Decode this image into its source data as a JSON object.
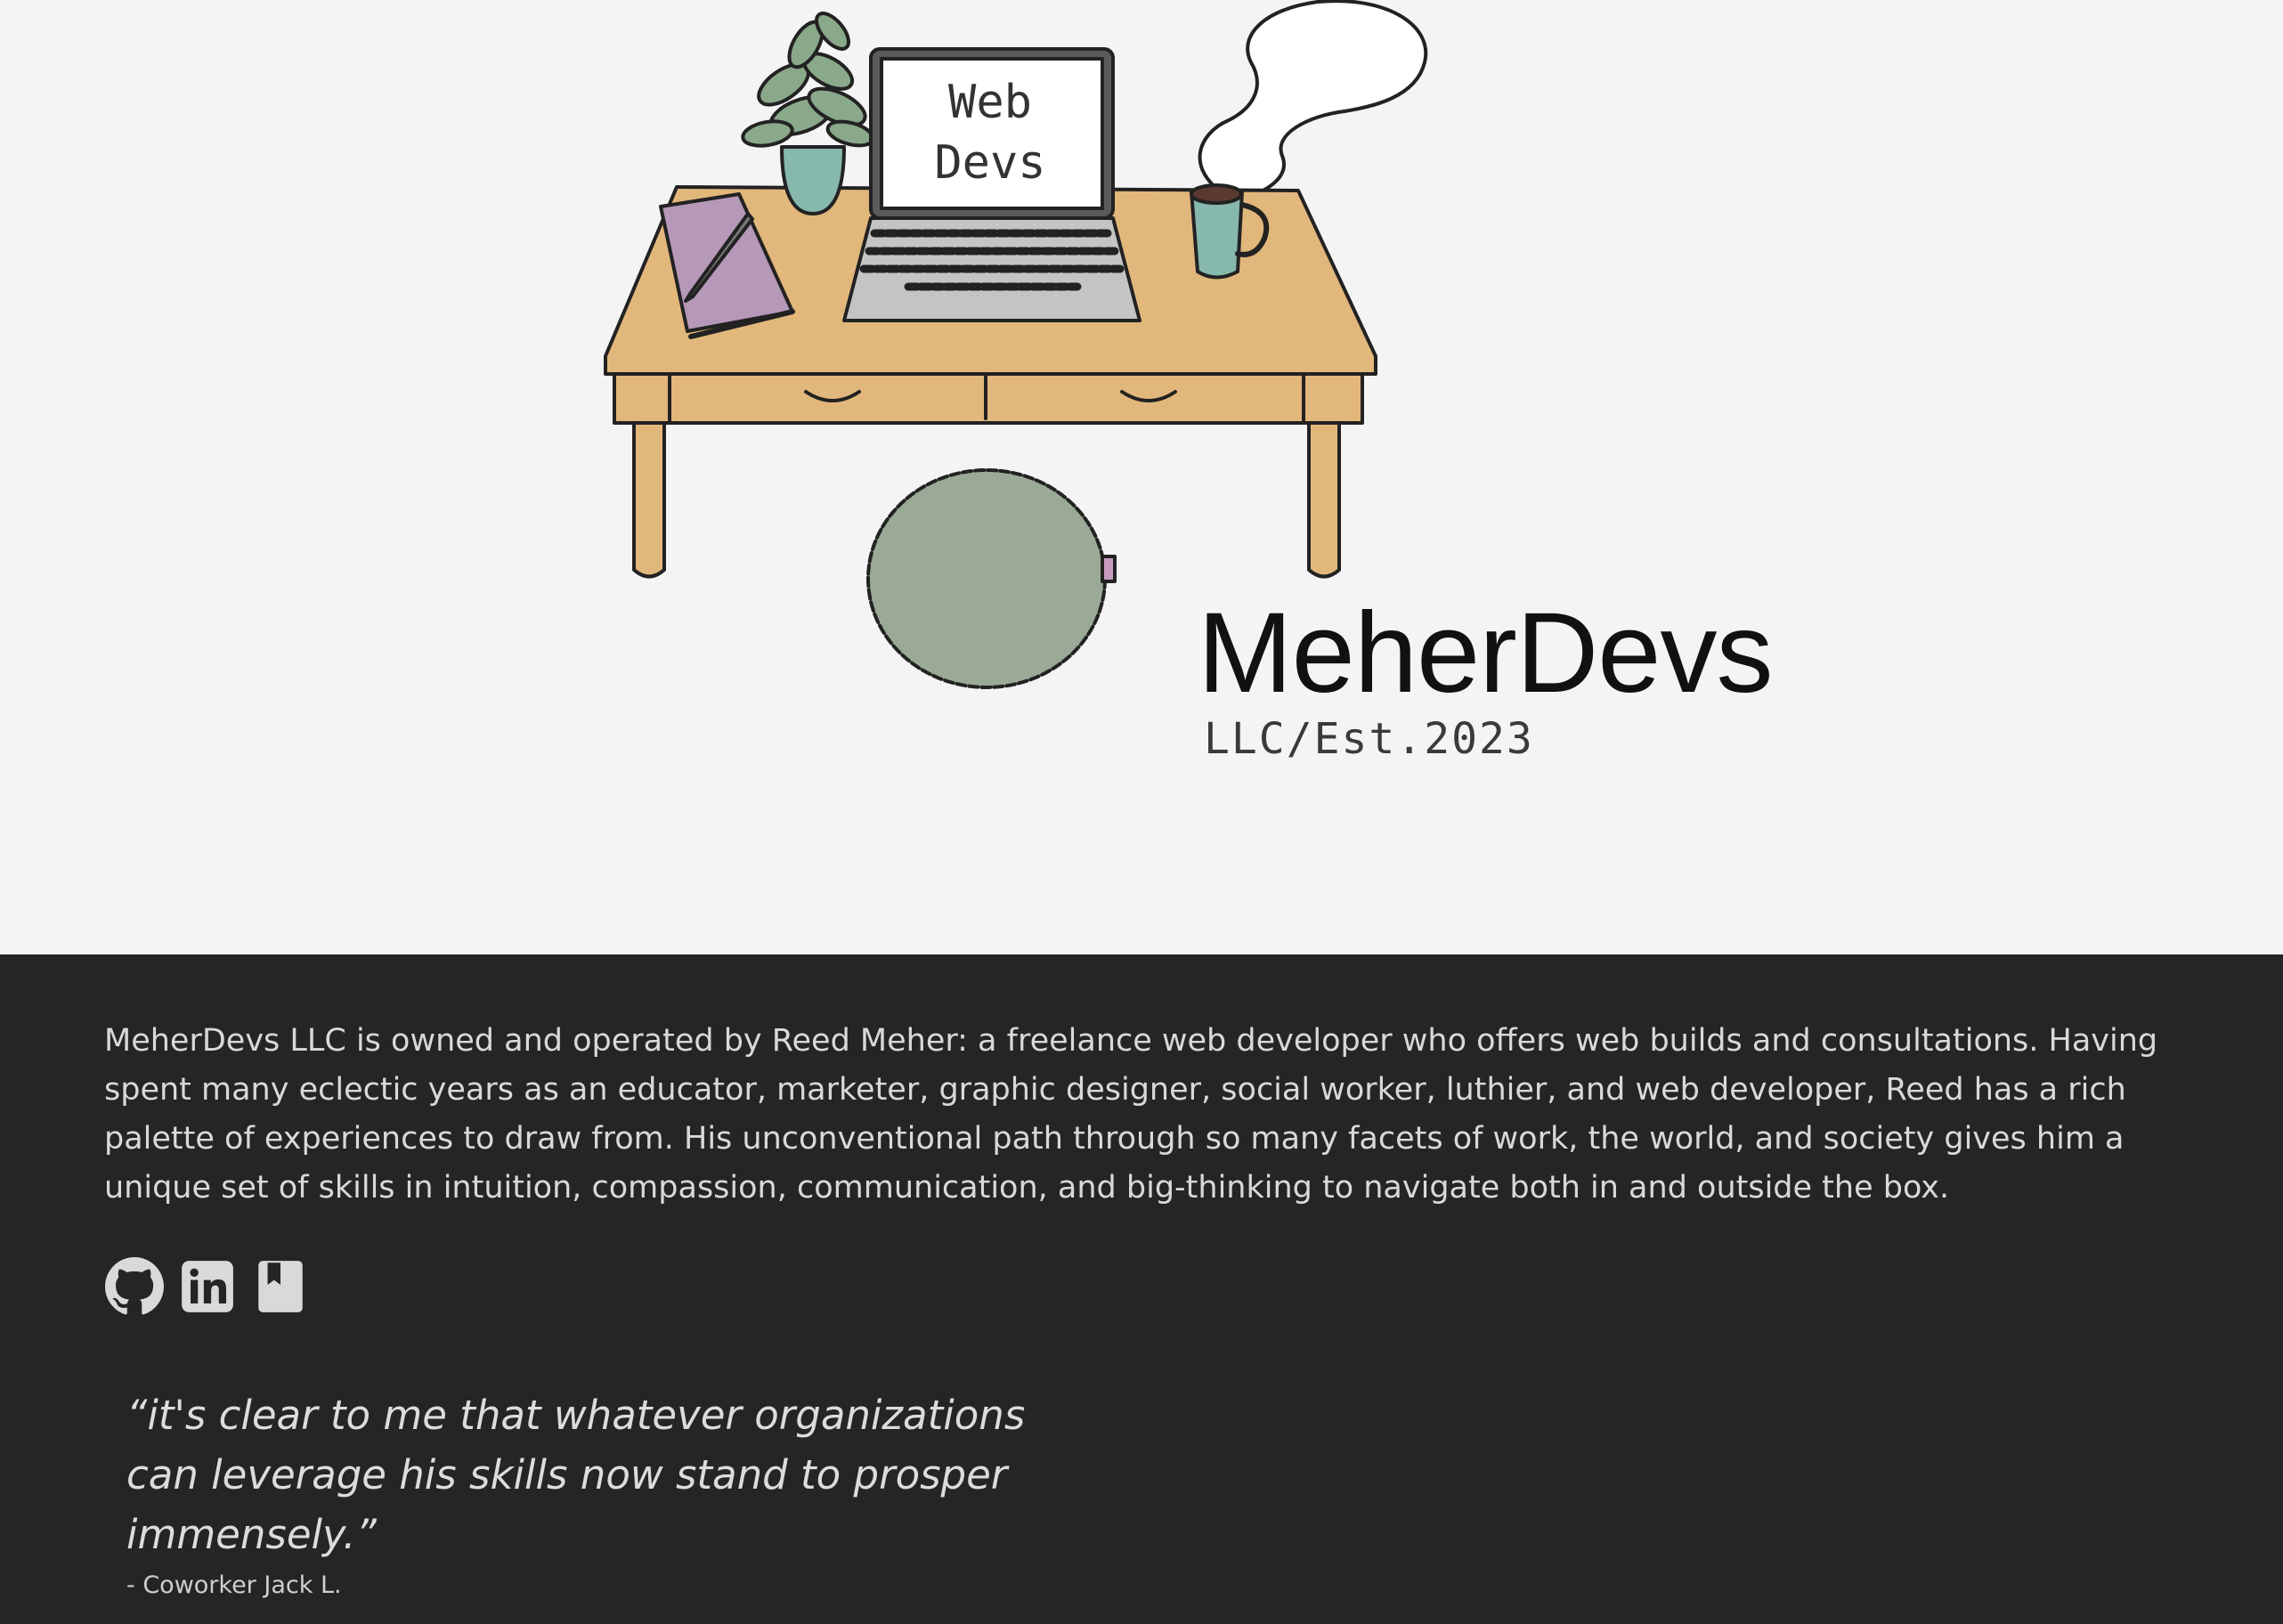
{
  "hero": {
    "brand_name": "MeherDevs",
    "brand_sub": "LLC/Est.2023",
    "laptop_screen_line1": "Web",
    "laptop_screen_line2": "Devs"
  },
  "about": {
    "text": "MeherDevs LLC is owned and operated by Reed Meher: a freelance web developer who offers web builds and consultations. Having spent many eclectic years as an educator, marketer, graphic designer, social worker, luthier, and web developer, Reed has a rich palette of experiences to draw from. His unconventional path through so many facets of work, the world, and society gives him a unique set of skills in intuition, compassion, communication, and big-thinking to navigate both in and outside the box."
  },
  "social": {
    "icons": [
      "github-icon",
      "linkedin-icon",
      "bookmark-icon"
    ]
  },
  "testimonial": {
    "quote": "“it's clear to me that whatever organizations can leverage his skills now stand to prosper immensely.”",
    "attribution": "- Coworker Jack L."
  },
  "colors": {
    "hero_background": "#f4f4f4",
    "content_background": "#242527",
    "desk": "#e2b77c",
    "cushion": "#9aaa96",
    "notebook": "#b698b8",
    "mug": "#86b8ad",
    "text_light": "#d9d9d9"
  }
}
